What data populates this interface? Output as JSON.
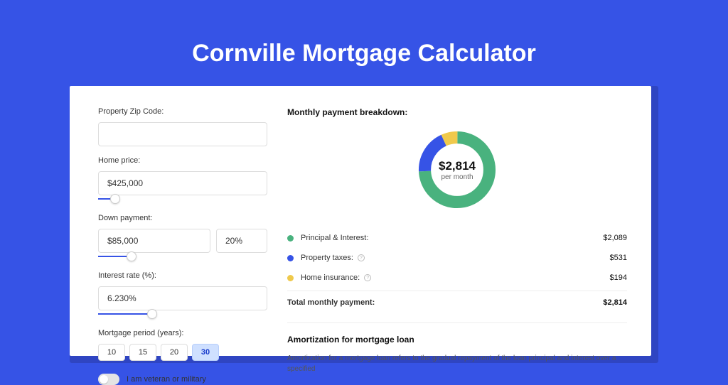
{
  "title": "Cornville Mortgage Calculator",
  "form": {
    "zip_label": "Property Zip Code:",
    "zip_value": "",
    "home_price_label": "Home price:",
    "home_price_value": "$425,000",
    "down_payment_label": "Down payment:",
    "down_payment_value": "$85,000",
    "down_payment_pct": "20%",
    "interest_label": "Interest rate (%):",
    "interest_value": "6.230%",
    "period_label": "Mortgage period (years):",
    "period_options": [
      "10",
      "15",
      "20",
      "30"
    ],
    "period_selected": "30",
    "veteran_label": "I am veteran or military"
  },
  "breakdown": {
    "heading": "Monthly payment breakdown:",
    "total_amount": "$2,814",
    "total_sub": "per month",
    "items": [
      {
        "label": "Principal & Interest:",
        "value": "$2,089",
        "color": "green"
      },
      {
        "label": "Property taxes:",
        "value": "$531",
        "color": "blue",
        "info": true
      },
      {
        "label": "Home insurance:",
        "value": "$194",
        "color": "yellow",
        "info": true
      }
    ],
    "total_label": "Total monthly payment:",
    "total_value": "$2,814"
  },
  "amortization": {
    "heading": "Amortization for mortgage loan",
    "text": "Amortization for a mortgage loan refers to the gradual repayment of the loan principal and interest over a specified"
  },
  "chart_data": {
    "type": "pie",
    "title": "Monthly payment breakdown",
    "series": [
      {
        "name": "Principal & Interest",
        "value": 2089,
        "color": "#49b27e"
      },
      {
        "name": "Property taxes",
        "value": 531,
        "color": "#3653e6"
      },
      {
        "name": "Home insurance",
        "value": 194,
        "color": "#efc94c"
      }
    ],
    "total": 2814,
    "center_label": "$2,814 per month"
  }
}
